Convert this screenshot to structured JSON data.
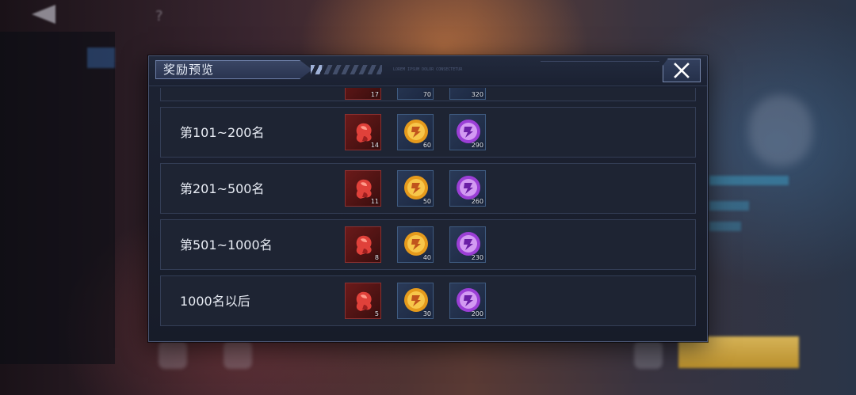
{
  "dialog": {
    "title": "奖励预览",
    "deco_text": "LOREM IPSUM DOLOR CONSECTETUR"
  },
  "partial_row": {
    "quantities": [
      "17",
      "70",
      "320"
    ]
  },
  "rows": [
    {
      "rank": "第101~200名",
      "rewards": [
        {
          "icon": "red-gem-icon",
          "qty": "14"
        },
        {
          "icon": "gold-coin-icon",
          "qty": "60"
        },
        {
          "icon": "purple-coin-icon",
          "qty": "290"
        }
      ]
    },
    {
      "rank": "第201~500名",
      "rewards": [
        {
          "icon": "red-gem-icon",
          "qty": "11"
        },
        {
          "icon": "gold-coin-icon",
          "qty": "50"
        },
        {
          "icon": "purple-coin-icon",
          "qty": "260"
        }
      ]
    },
    {
      "rank": "第501~1000名",
      "rewards": [
        {
          "icon": "red-gem-icon",
          "qty": "8"
        },
        {
          "icon": "gold-coin-icon",
          "qty": "40"
        },
        {
          "icon": "purple-coin-icon",
          "qty": "230"
        }
      ]
    },
    {
      "rank": "1000名以后",
      "rewards": [
        {
          "icon": "red-gem-icon",
          "qty": "5"
        },
        {
          "icon": "gold-coin-icon",
          "qty": "30"
        },
        {
          "icon": "purple-coin-icon",
          "qty": "200"
        }
      ]
    }
  ],
  "colors": {
    "panel": "#1d2333",
    "row": "#1e2433",
    "border": "#4a5674",
    "text": "#e8ecf4"
  }
}
